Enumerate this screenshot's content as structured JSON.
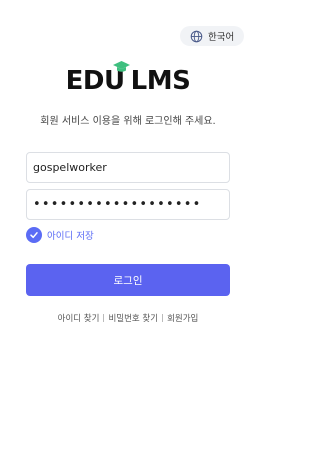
{
  "language": {
    "icon": "globe-icon",
    "label": "한국어"
  },
  "logo": {
    "left_text": "EDU",
    "right_text": "LMS",
    "cap_icon": "graduation-cap-icon",
    "cap_color": "#3fbf7f"
  },
  "subtitle": "회원 서비스 이용을 위해 로그인해 주세요.",
  "form": {
    "username_value": "gospelworker",
    "password_value": "•••••••••••••••••••",
    "remember_label": "아이디 저장",
    "remember_checked": true,
    "submit_label": "로그인"
  },
  "links": {
    "find_id": "아이디 찾기",
    "find_password": "비밀번호 찾기",
    "signup": "회원가입"
  },
  "colors": {
    "accent": "#5b63f0",
    "check": "#5b6cf5"
  }
}
